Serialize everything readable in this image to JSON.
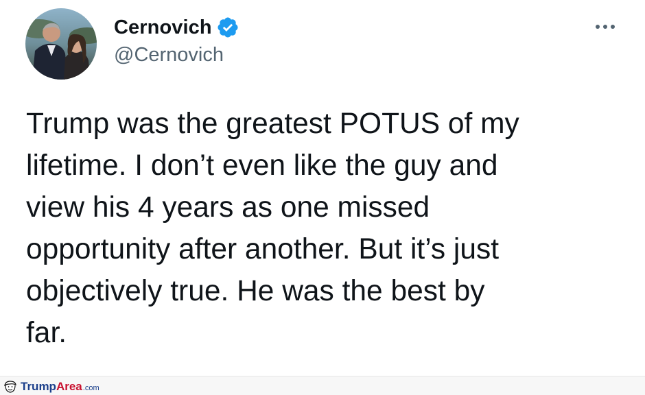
{
  "tweet": {
    "display_name": "Cernovich",
    "handle": "@Cernovich",
    "verified": true,
    "verified_color": "#1d9bf0",
    "text": "Trump was the greatest POTUS of my\nlifetime. I don’t even like the guy and\nview his 4 years as one missed\nopportunity after another. But it’s just\nobjectively true. He was the best by\nfar.",
    "avatar_icon": "profile-photo",
    "more_icon": "more-horizontal-icon"
  },
  "watermark": {
    "brand_part1": "Trump",
    "brand_part2": "Area",
    "suffix": ".com",
    "logo_icon": "trump-face-logo",
    "color_blue": "#1b3f8b",
    "color_red": "#c8102e"
  }
}
